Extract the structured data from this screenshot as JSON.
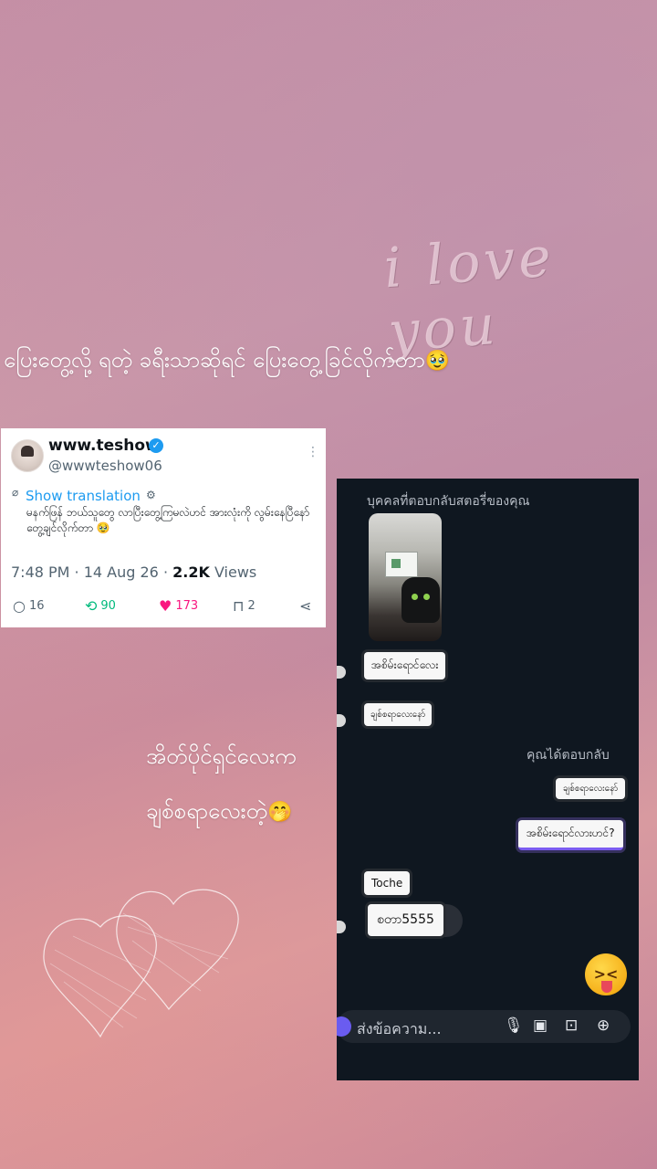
{
  "overlay": {
    "love_text": "i love you",
    "caption_top": "ပြေးတွေ့လို့ ရတဲ့ ခရီးသာဆိုရင် ပြေးတွေ့ခြင်လိုက်တာ",
    "caption_top_emoji": "🥹",
    "caption_mid_line1": "အိတ်ပိုင်ရှင်လေးက",
    "caption_mid_line2": "ချစ်စရာလေးတဲ့",
    "caption_mid_emoji": "🤭"
  },
  "tweet": {
    "display_name": "www.teshow",
    "handle": "@wwwteshow06",
    "translate_label": "Show translation",
    "body": "မနက်ဖြန် ဘယ်သူတွေ လာပြီးတွေ့ကြမလဲဟင် အားလုံးကို လွမ်းနေပြီနော် တွေ့ချင်လိုက်တာ 🥹",
    "time": "7:48 PM · 14 Aug 26 · ",
    "views_count": "2.2K",
    "views_label": " Views",
    "replies": "16",
    "retweets": "90",
    "likes": "173",
    "bookmarks": "2",
    "colors": {
      "retweet": "#00ba7c",
      "like": "#f91880",
      "link": "#1d9bf0"
    }
  },
  "chat": {
    "header": "บุคคลที่ตอบกลับสตอรี่ของคุณ",
    "messages_in": [
      "အစိမ်းရောင်လေး",
      "ချစ်စရာလေးနော်"
    ],
    "replied_label": "คุณได้ตอบกลับ",
    "messages_out": [
      "ချစ်စရာလေးနော်",
      "အစိမ်းရောင်လားဟင်?"
    ],
    "toche": "Toche",
    "last_message": "စတာ5555",
    "composer_placeholder": "ส่งข้อความ...",
    "icons": [
      "camera-icon",
      "mic-icon",
      "gallery-icon",
      "sticker-icon",
      "plus-icon"
    ]
  }
}
